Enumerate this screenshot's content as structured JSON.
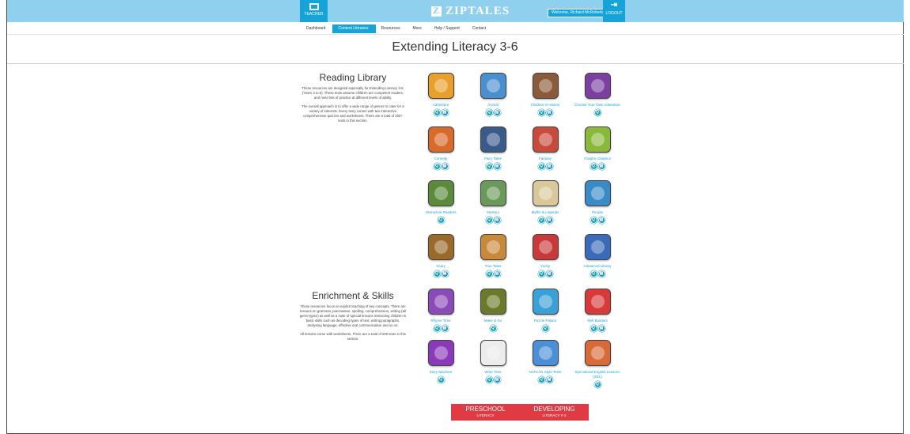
{
  "header": {
    "teacher_label": "TEACHER",
    "brand": "ZIPTALES",
    "welcome": "Welcome, Richard McRoberts",
    "logout_label": "LOGOUT"
  },
  "nav": [
    "Dashboard",
    "Content Libraries",
    "Resources",
    "More",
    "Help / Support",
    "Contact"
  ],
  "page_title": "Extending Literacy 3-6",
  "reading": {
    "title": "Reading Library",
    "p1": "These resources are designed especially for Extending Literacy 3-6, (Years 3 to 6). These texts assume children are competent readers, and need lots of practice at different levels of ability.",
    "p2": "The overall approach is to offer a wide range of genres to cater for a variety of interests. Every story comes with two interactive comprehension quizzes and worksheets. There are a total of 200+ texts in this section."
  },
  "enrichment": {
    "title": "Enrichment & Skills",
    "p1": "These resources focus on explicit teaching of key concepts. There are lessons on grammar, punctuation, spelling, comprehension, writing (all genre types) as well as a suite of special lessons instructing children in basic skills such as decoding types of text, writing paragraphs, analysing language, effective oral communication and so on.",
    "p2": "All lessons come with worksheets. There are a total of 200 texts in this section."
  },
  "tiles": [
    {
      "label": "Adventure",
      "color": "#e8a02a",
      "docs": true
    },
    {
      "label": "Animal",
      "color": "#4a8fd0",
      "docs": true
    },
    {
      "label": "Children in History",
      "color": "#8a5a3a",
      "docs": true
    },
    {
      "label": "Choose Your Own Adventure",
      "color": "#7a3fa0",
      "docs": false
    },
    {
      "label": "Comedy",
      "color": "#d86a2a",
      "docs": true
    },
    {
      "label": "Fairy Tales",
      "color": "#3a5a8a",
      "docs": true
    },
    {
      "label": "Fantasy",
      "color": "#c84a3a",
      "docs": true
    },
    {
      "label": "Graphic Classics",
      "color": "#8ab83a",
      "docs": true
    },
    {
      "label": "Interactive Readers",
      "color": "#5a8a3a",
      "docs": false
    },
    {
      "label": "Mystery",
      "color": "#6a9a5a",
      "docs": true
    },
    {
      "label": "Myths & Legends",
      "color": "#d8c89a",
      "docs": true
    },
    {
      "label": "People",
      "color": "#3a8ac8",
      "docs": true
    },
    {
      "label": "Scary",
      "color": "#9a6a2a",
      "docs": true
    },
    {
      "label": "True Tales",
      "color": "#c88a3a",
      "docs": true
    },
    {
      "label": "Yucky",
      "color": "#c83a3a",
      "docs": true
    },
    {
      "label": "Advanced Library",
      "color": "#3a6ab8",
      "docs": true
    },
    {
      "label": "Rhyme Time",
      "color": "#8a4ab8",
      "docs": true
    },
    {
      "label": "Make & Do",
      "color": "#6a7a2a",
      "docs": false
    },
    {
      "label": "Puzzle Palace",
      "color": "#3aa0d8",
      "docs": false
    },
    {
      "label": "Skill Builders",
      "color": "#d83a3a",
      "docs": true
    },
    {
      "label": "Story Machine",
      "color": "#8a3ab8",
      "docs": false
    },
    {
      "label": "Write Time",
      "color": "#ececec",
      "docs": true
    },
    {
      "label": "NAPLAN Style Tests",
      "color": "#4a90d8",
      "docs": true
    },
    {
      "label": "Specialised English Lessons (SEL)",
      "color": "#d86a3a",
      "docs": false
    }
  ],
  "bottom_buttons": [
    {
      "l1": "PRESCHOOL",
      "l2": "LITERACY"
    },
    {
      "l1": "DEVELOPING",
      "l2": "LITERACY F-2"
    }
  ],
  "colors": {
    "topbar": "#8fd0ef",
    "accent": "#15a3d8",
    "cta": "#e03a45"
  }
}
